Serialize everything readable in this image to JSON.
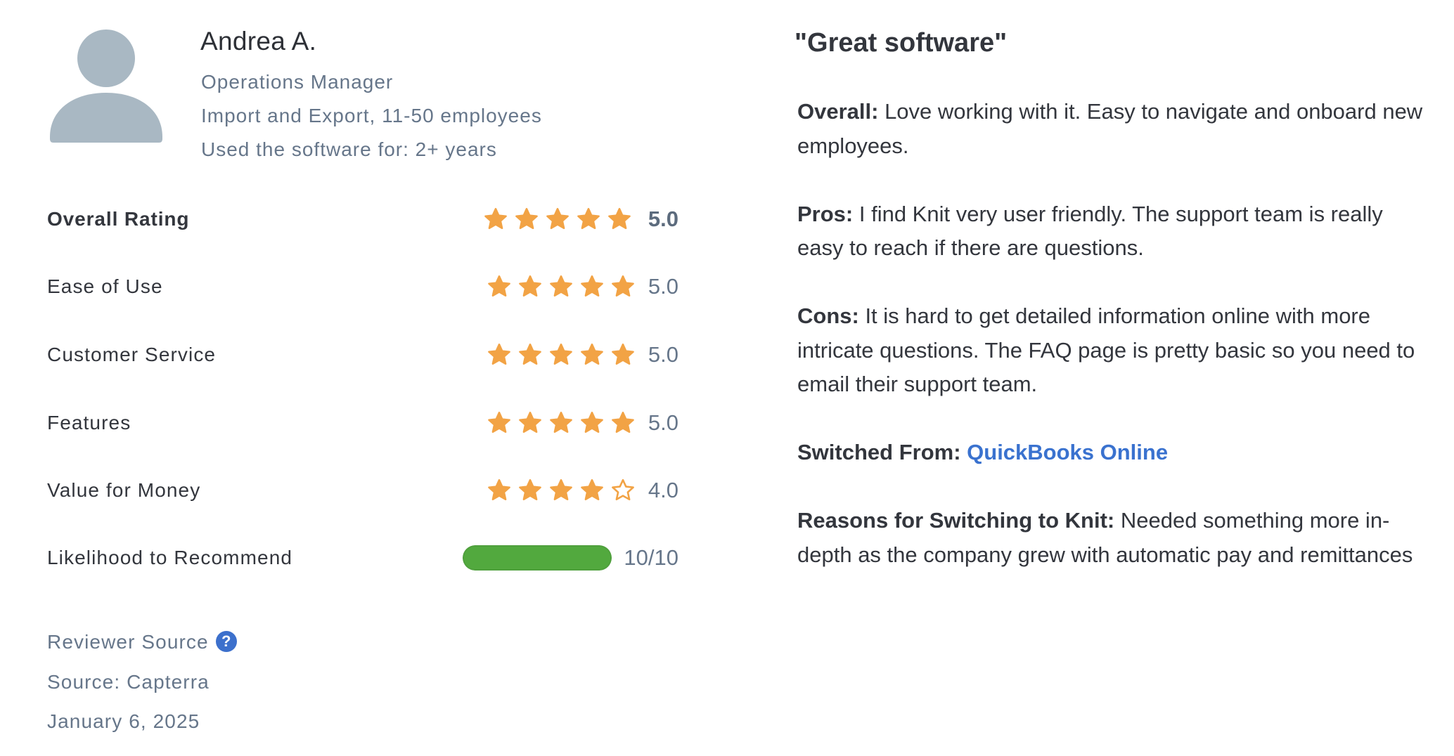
{
  "reviewer": {
    "name": "Andrea A.",
    "job_title": "Operations Manager",
    "company_info": "Import and Export, 11-50 employees",
    "usage_duration": "Used the software for: 2+ years",
    "avatar_icon": "user-silhouette-icon"
  },
  "ratings": {
    "overall": {
      "label": "Overall Rating",
      "value": 5.0,
      "display": "5.0"
    },
    "items": [
      {
        "label": "Ease of Use",
        "value": 5.0,
        "display": "5.0"
      },
      {
        "label": "Customer Service",
        "value": 5.0,
        "display": "5.0"
      },
      {
        "label": "Features",
        "value": 5.0,
        "display": "5.0"
      },
      {
        "label": "Value for Money",
        "value": 4.0,
        "display": "4.0"
      }
    ],
    "max_stars": 5,
    "recommend": {
      "label": "Likelihood to Recommend",
      "value": 10,
      "max": 10,
      "display": "10/10"
    }
  },
  "source": {
    "reviewer_source_label": "Reviewer Source",
    "help_icon": "?",
    "source_text": "Source: Capterra",
    "date": "January 6, 2025"
  },
  "review": {
    "title": "\"Great software\"",
    "overall_label": "Overall:",
    "overall_text": " Love working with it. Easy to navigate and onboard new employees.",
    "pros_label": "Pros:",
    "pros_text": " I find Knit very user friendly. The support team is really easy to reach if there are questions.",
    "cons_label": "Cons:",
    "cons_text": " It is hard to get detailed information online with more intricate questions. The FAQ page is pretty basic so you need to email their support team.",
    "switched_label": "Switched From:",
    "switched_link": "QuickBooks Online",
    "reasons_label": "Reasons for Switching to Knit:",
    "reasons_text": " Needed something more in-depth as the company grew with automatic pay and remittances"
  },
  "colors": {
    "star": "#f2a345",
    "progress": "#52a93e",
    "link": "#3a72cf",
    "avatar": "#a9b8c3",
    "help_icon": "#3c70cc"
  }
}
